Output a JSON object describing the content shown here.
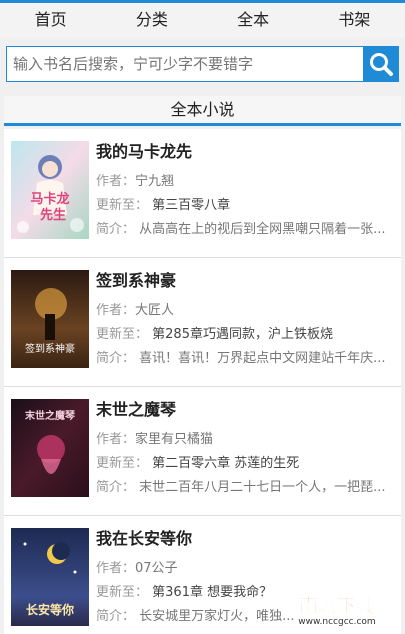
{
  "nav": {
    "items": [
      "首页",
      "分类",
      "全本",
      "书架"
    ]
  },
  "search": {
    "placeholder": "输入书名后搜索，宁可少字不要错字"
  },
  "section": {
    "title": "全本小说"
  },
  "labels": {
    "author": "作者：",
    "updated": "更新至：",
    "intro": "简介："
  },
  "books": [
    {
      "title": "我的马卡龙先",
      "author": "宁九翘",
      "updated": "第三百零八章",
      "intro": "从高高在上的视后到全网黑嘲只隔着一张...",
      "cover_text": [
        "马卡龙",
        "先生"
      ],
      "cover_colors": [
        "#bde6ee",
        "#f4dbe7",
        "#a7d7c4"
      ]
    },
    {
      "title": "签到系神豪",
      "author": "大匠人",
      "updated": "第285章巧遇同款，沪上铁板烧",
      "intro": "喜讯！喜讯！万界起点中文网建站千年庆...",
      "cover_text": [
        "签到系神豪"
      ],
      "cover_colors": [
        "#2b1a12",
        "#6a4322",
        "#d79a3e"
      ]
    },
    {
      "title": "末世之魔琴",
      "author": "家里有只橘猫",
      "updated": "第二百零六章 苏莲的生死",
      "intro": "末世二百年八月二十七日一个人，一把琵...",
      "cover_text": [
        "末世之魔琴"
      ],
      "cover_colors": [
        "#1a0f18",
        "#4a1a2a",
        "#c4386a"
      ]
    },
    {
      "title": "我在长安等你",
      "author": "07公子",
      "updated": "第361章 想要我命？",
      "intro": "长安城里万家灯火，唯独...",
      "cover_text": [
        "长安等你"
      ],
      "cover_colors": [
        "#1d2a52",
        "#3c4e8c",
        "#f0c84c"
      ]
    }
  ],
  "watermark": {
    "text": "南城下载",
    "url": "www.nccgcc.com"
  }
}
